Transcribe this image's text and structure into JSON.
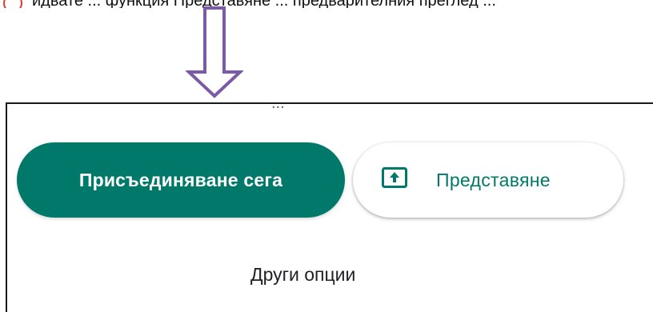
{
  "top_line": {
    "text": "идвате ... функция Представяне ... предварителния преглед ..."
  },
  "arrow": {
    "color": "#7b5aa6"
  },
  "panel": {
    "top_fragment": "...",
    "join_button": {
      "label": "Присъединяване сега",
      "color": "#00796b"
    },
    "present_button": {
      "label": "Представяне",
      "icon": "present-screen-icon",
      "color": "#00796b"
    },
    "other_options": {
      "label": "Други опции"
    }
  }
}
